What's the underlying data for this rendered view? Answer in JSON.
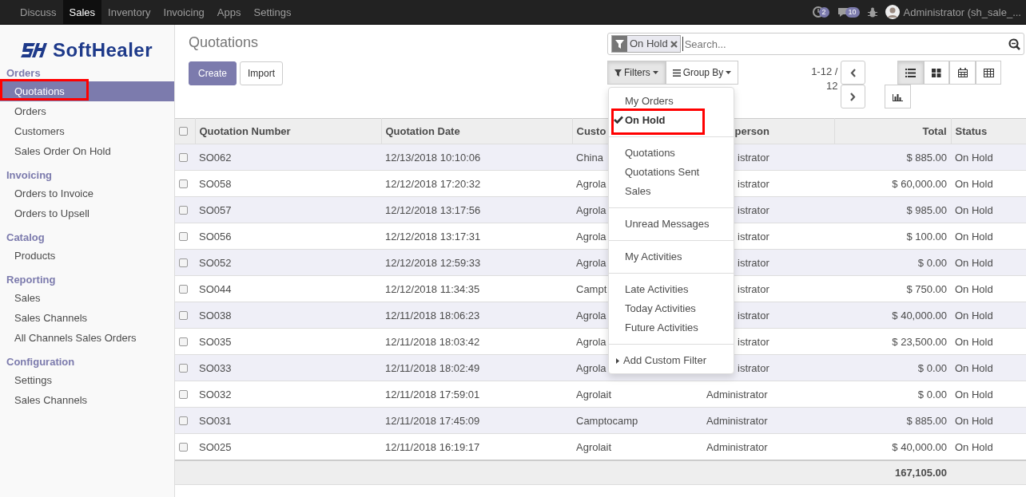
{
  "topbar": {
    "apps": [
      {
        "label": "Discuss",
        "selected": false
      },
      {
        "label": "Sales",
        "selected": true
      },
      {
        "label": "Inventory",
        "selected": false
      },
      {
        "label": "Invoicing",
        "selected": false
      },
      {
        "label": "Apps",
        "selected": false
      },
      {
        "label": "Settings",
        "selected": false
      }
    ],
    "activity_badge": "2",
    "messages_badge": "10",
    "user": "Administrator (sh_sale_..."
  },
  "sidebar": {
    "logo": "SoftHealer",
    "sections": [
      {
        "title": "Orders",
        "items": [
          {
            "label": "Quotations",
            "selected": true,
            "highlight": true
          },
          {
            "label": "Orders",
            "selected": false,
            "highlight": false
          },
          {
            "label": "Customers",
            "selected": false,
            "highlight": false
          },
          {
            "label": "Sales Order On Hold",
            "selected": false,
            "highlight": false
          }
        ]
      },
      {
        "title": "Invoicing",
        "items": [
          {
            "label": "Orders to Invoice",
            "selected": false,
            "highlight": false
          },
          {
            "label": "Orders to Upsell",
            "selected": false,
            "highlight": false
          }
        ]
      },
      {
        "title": "Catalog",
        "items": [
          {
            "label": "Products",
            "selected": false,
            "highlight": false
          }
        ]
      },
      {
        "title": "Reporting",
        "items": [
          {
            "label": "Sales",
            "selected": false,
            "highlight": false
          },
          {
            "label": "Sales Channels",
            "selected": false,
            "highlight": false
          },
          {
            "label": "All Channels Sales Orders",
            "selected": false,
            "highlight": false
          }
        ]
      },
      {
        "title": "Configuration",
        "items": [
          {
            "label": "Settings",
            "selected": false,
            "highlight": false
          },
          {
            "label": "Sales Channels",
            "selected": false,
            "highlight": false
          }
        ]
      }
    ]
  },
  "control": {
    "title": "Quotations",
    "buttons": [
      "Create",
      "Import"
    ],
    "search": {
      "facet": "On Hold",
      "placeholder": "Search..."
    },
    "filters_button": "Filters",
    "groupby_button": "Group By",
    "pager": "1-12 / 12",
    "views": [
      {
        "kind": "list",
        "selected": true
      },
      {
        "kind": "kanban",
        "selected": false
      },
      {
        "kind": "calendar",
        "selected": false
      },
      {
        "kind": "pivot",
        "selected": false
      },
      {
        "kind": "graph",
        "selected": false
      }
    ]
  },
  "filter_menu": {
    "groups": [
      [
        {
          "label": "My Orders",
          "checked": false,
          "highlight": false
        },
        {
          "label": "On Hold",
          "checked": true,
          "highlight": true
        }
      ],
      [
        {
          "label": "Quotations",
          "checked": false,
          "highlight": false
        },
        {
          "label": "Quotations Sent",
          "checked": false,
          "highlight": false
        },
        {
          "label": "Sales",
          "checked": false,
          "highlight": false
        }
      ],
      [
        {
          "label": "Unread Messages",
          "checked": false,
          "highlight": false
        }
      ],
      [
        {
          "label": "My Activities",
          "checked": false,
          "highlight": false
        }
      ],
      [
        {
          "label": "Late Activities",
          "checked": false,
          "highlight": false
        },
        {
          "label": "Today Activities",
          "checked": false,
          "highlight": false
        },
        {
          "label": "Future Activities",
          "checked": false,
          "highlight": false
        }
      ]
    ],
    "custom": "Add Custom Filter"
  },
  "table": {
    "all_checked": false,
    "columns": [
      "Quotation Number",
      "Quotation Date",
      "Custo",
      "person",
      "Total",
      "Status"
    ],
    "rows": [
      {
        "number": "SO062",
        "date": "12/13/2018 10:10:06",
        "customer": "China",
        "salesperson": "istrator",
        "covered": true,
        "total": "$ 885.00",
        "status": "On Hold",
        "checked": false
      },
      {
        "number": "SO058",
        "date": "12/12/2018 17:20:32",
        "customer": "Agrola",
        "salesperson": "istrator",
        "covered": true,
        "total": "$ 60,000.00",
        "status": "On Hold",
        "checked": false
      },
      {
        "number": "SO057",
        "date": "12/12/2018 13:17:56",
        "customer": "Agrola",
        "salesperson": "istrator",
        "covered": true,
        "total": "$ 985.00",
        "status": "On Hold",
        "checked": false
      },
      {
        "number": "SO056",
        "date": "12/12/2018 13:17:31",
        "customer": "Agrola",
        "salesperson": "istrator",
        "covered": true,
        "total": "$ 100.00",
        "status": "On Hold",
        "checked": false
      },
      {
        "number": "SO052",
        "date": "12/12/2018 12:59:33",
        "customer": "Agrola",
        "salesperson": "istrator",
        "covered": true,
        "total": "$ 0.00",
        "status": "On Hold",
        "checked": false
      },
      {
        "number": "SO044",
        "date": "12/12/2018 11:34:35",
        "customer": "Campt",
        "salesperson": "istrator",
        "covered": true,
        "total": "$ 750.00",
        "status": "On Hold",
        "checked": false
      },
      {
        "number": "SO038",
        "date": "12/11/2018 18:06:23",
        "customer": "Agrola",
        "salesperson": "istrator",
        "covered": true,
        "total": "$ 40,000.00",
        "status": "On Hold",
        "checked": false
      },
      {
        "number": "SO035",
        "date": "12/11/2018 18:03:42",
        "customer": "Agrola",
        "salesperson": "istrator",
        "covered": true,
        "total": "$ 23,500.00",
        "status": "On Hold",
        "checked": false
      },
      {
        "number": "SO033",
        "date": "12/11/2018 18:02:49",
        "customer": "Agrola",
        "salesperson": "istrator",
        "covered": true,
        "total": "$ 0.00",
        "status": "On Hold",
        "checked": false
      },
      {
        "number": "SO032",
        "date": "12/11/2018 17:59:01",
        "customer": "Agrolait",
        "salesperson": "Administrator",
        "covered": false,
        "total": "$ 0.00",
        "status": "On Hold",
        "checked": false
      },
      {
        "number": "SO031",
        "date": "12/11/2018 17:45:09",
        "customer": "Camptocamp",
        "salesperson": "Administrator",
        "covered": false,
        "total": "$ 885.00",
        "status": "On Hold",
        "checked": false
      },
      {
        "number": "SO025",
        "date": "12/11/2018 16:19:17",
        "customer": "Agrolait",
        "salesperson": "Administrator",
        "covered": false,
        "total": "$ 40,000.00",
        "status": "On Hold",
        "checked": false
      }
    ],
    "grand_total": "167,105.00"
  }
}
